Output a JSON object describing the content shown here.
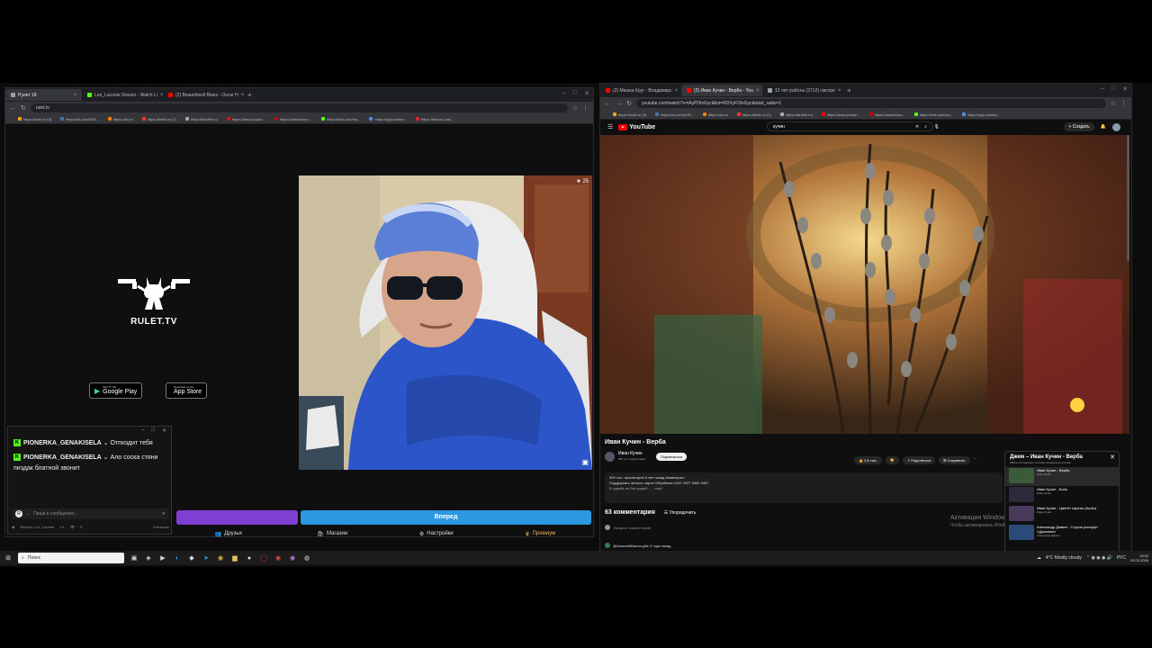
{
  "left_browser": {
    "tabs": [
      {
        "label": "Рулет 18",
        "color": "#9aa0a6",
        "active": true
      },
      {
        "label": "Loo_Lacoste Stream - Watch Li",
        "color": "#53fc18",
        "active": false
      },
      {
        "label": "(2) Beauntiwoll Blues - Oscar H",
        "color": "#ff0000",
        "active": false
      }
    ],
    "new_tab": "+",
    "url": "rulet.tv",
    "bookmarks": [
      {
        "label": "https://mail.ru/ (3)",
        "color": "#f4a020"
      },
      {
        "label": "https://vk.com/id78...",
        "color": "#4a76a8"
      },
      {
        "label": "https://ok.ru/",
        "color": "#ee8208"
      },
      {
        "label": "https://tentli.ru/ (1)",
        "color": "#ff3333"
      },
      {
        "label": "https://tarolife.ru/",
        "color": "#aaaaaa"
      },
      {
        "label": "https://www.youtub...",
        "color": "#ff0000"
      },
      {
        "label": "https://www.terou.r...",
        "color": "#cc0000"
      },
      {
        "label": "https://kick.com/loo...",
        "color": "#53fc18"
      },
      {
        "label": "https://app.rostrea...",
        "color": "#4a90e2"
      },
      {
        "label": "https://eltorrou.ma/...",
        "color": "#dd2222"
      }
    ],
    "logo_text": "RULET.TV",
    "google_play": {
      "small": "GET IT ON",
      "big": "Google Play"
    },
    "app_store": {
      "small": "Download on the",
      "big": "App Store"
    },
    "viewer_count": "25",
    "next_button": "Вперед",
    "bottom_nav": [
      "Друзья",
      "Магазин",
      "Настройки",
      "Премиум"
    ]
  },
  "chat": {
    "messages": [
      {
        "user": "PIONERKA_GENAKISELA",
        "text": "Отпиздит тебя"
      },
      {
        "user": "PIONERKA_GENAKISELA",
        "text": "Ало соска стяни пиздак блатной звонит"
      }
    ],
    "input_placeholder": "Пиши в сообщения...",
    "avatar_letter": "R",
    "status_user": "Вевили Loo_Lacoste",
    "status_count": "1/1",
    "status_viewers": "5",
    "status_extra": "Активные"
  },
  "right_browser": {
    "tabs": [
      {
        "label": "(2) Мишка Круг - Владимирс",
        "color": "#ff0000",
        "active": false
      },
      {
        "label": "(2) Иван Кучин - Верба - You",
        "color": "#ff0000",
        "active": true
      },
      {
        "label": "12 лет работы (2712) смотре",
        "color": "#9aa0a6",
        "active": false
      }
    ],
    "url": "youtube.com/watch?v=iAyPDtxGyc&list=RDXyFDtxGyc&start_radio=1",
    "bookmarks": [
      {
        "label": "https://mail.ru/ (3)",
        "color": "#f4a020"
      },
      {
        "label": "https://vk.com/id78...",
        "color": "#4a76a8"
      },
      {
        "label": "https://ok.ru/",
        "color": "#ee8208"
      },
      {
        "label": "https://tentli.ru/ (1)",
        "color": "#ff3333"
      },
      {
        "label": "https://tarolife.ru/",
        "color": "#aaaaaa"
      },
      {
        "label": "https://www.youtub...",
        "color": "#ff0000"
      },
      {
        "label": "https://www.terou...",
        "color": "#cc0000"
      },
      {
        "label": "https://kick.com/loo...",
        "color": "#53fc18"
      },
      {
        "label": "https://app.rostrea...",
        "color": "#4a90e2"
      }
    ],
    "yt_logo": "YouTube",
    "search_value": "кучин",
    "create_label": "Создать",
    "video_title": "Иван Кучин - Верба",
    "channel_name": "Иван Кучин",
    "subscribers": "386 тыс. подписчиков",
    "subscribe_label": "Подписаться",
    "likes": "2,8 тыс.",
    "share_label": "Поделиться",
    "save_label": "Сохранить",
    "desc_line1": "309 тыс. просмотров  6 лет назад  #иванкучин",
    "desc_line2": "Поддержать автора: карта Сбербанка 2202 2007 8381 9487",
    "desc_line3": "В судьбе не без ущерб… ...ещё",
    "comments_count": "63 комментария",
    "sort_label": "Упорядочить",
    "add_comment": "Введите комментарий",
    "first_comment": "@АлексейМанин-д9е 3 года назад",
    "mix_title": "Джем – Иван Кучин - Верба",
    "mix_sub": "Миксы составлены YouTube специально для вас",
    "mix_items": [
      {
        "title": "Иван Кучин - Верба",
        "channel": "Иван Кучин"
      },
      {
        "title": "Иван Кучин - Боль",
        "channel": "Иван Кучин"
      },
      {
        "title": "Иван Кучин - Цветёт сирень (Audio)",
        "channel": "Иван Кучин"
      },
      {
        "title": "Александр Дюмин - Струна (концерт «Душевно»",
        "channel": "Александр Дюмин"
      }
    ],
    "watermark_1": "Активация Windows",
    "watermark_2": "Чтобы активировать Windows, перейдите в раздел \"Параметры\""
  },
  "taskbar": {
    "search_placeholder": "Поиск",
    "weather": "4°C  Mostly cloudy",
    "lang": "РУС",
    "time": "13:52",
    "date": "02.01.2026"
  }
}
